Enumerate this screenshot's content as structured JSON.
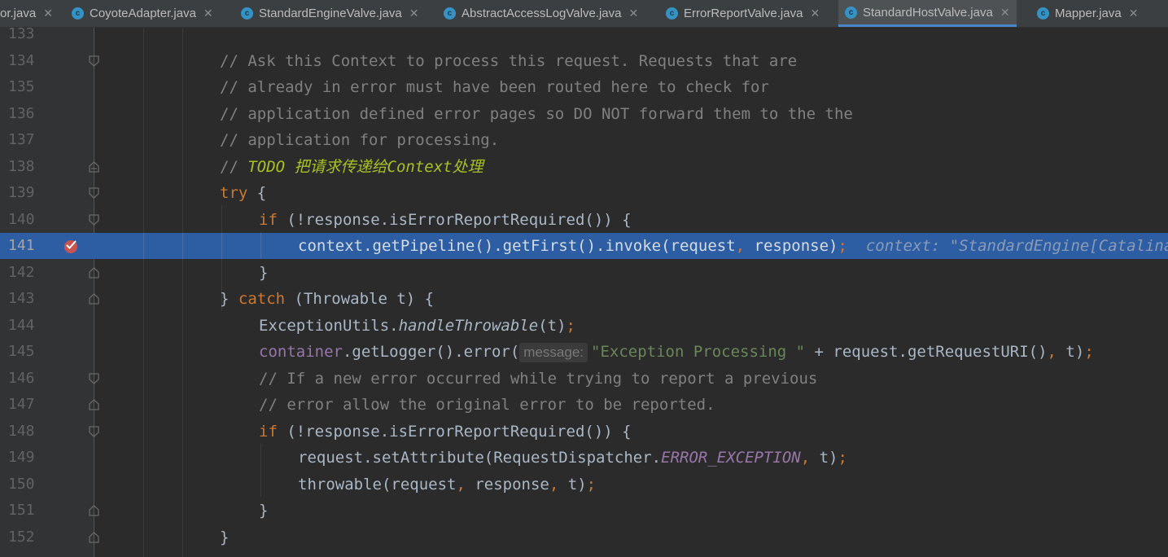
{
  "tabs": [
    {
      "label": "or.java",
      "active": false,
      "icon": false
    },
    {
      "label": "CoyoteAdapter.java",
      "active": false,
      "icon": true
    },
    {
      "label": "StandardEngineValve.java",
      "active": false,
      "icon": true
    },
    {
      "label": "AbstractAccessLogValve.java",
      "active": false,
      "icon": true
    },
    {
      "label": "ErrorReportValve.java",
      "active": false,
      "icon": true
    },
    {
      "label": "StandardHostValve.java",
      "active": true,
      "icon": true
    },
    {
      "label": "Mapper.java",
      "active": false,
      "icon": true
    }
  ],
  "tab_icon_letter": "c",
  "close_glyph": "✕",
  "lines": [
    {
      "num": "133"
    },
    {
      "num": "134",
      "comment": "// Ask this Context to process this request. Requests that are"
    },
    {
      "num": "135",
      "comment": "// already in error must have been routed here to check for"
    },
    {
      "num": "136",
      "comment": "// application defined error pages so DO NOT forward them to the the"
    },
    {
      "num": "137",
      "comment": "// application for processing."
    },
    {
      "num": "138",
      "comment": "// ",
      "todo": "TODO 把请求传递给Context处理"
    },
    {
      "num": "139",
      "kw": "try",
      "rest": " {"
    },
    {
      "num": "140",
      "kw": "if",
      "rest": " (!response.isErrorReportRequired()) {"
    },
    {
      "num": "141",
      "code": "context.getPipeline().getFirst().invoke(request",
      "comma": ",",
      "code2": " response)",
      "semi": ";",
      "debug": "context: \"StandardEngine[Catalina]"
    },
    {
      "num": "142",
      "rest": "}"
    },
    {
      "num": "143",
      "pre": "} ",
      "kw": "catch",
      "rest": " (Throwable t) {"
    },
    {
      "num": "144",
      "pre": "ExceptionUtils.",
      "italic": "handleThrowable",
      "rest": "(t)",
      "semi": ";"
    },
    {
      "num": "145",
      "field": "container",
      "rest": ".getLogger().error(",
      "hint": "message:",
      "string": "\"Exception Processing \"",
      "rest2": " + request.getRequestURI()",
      "comma": ",",
      "rest3": " t)",
      "semi": ";"
    },
    {
      "num": "146",
      "comment": "// If a new error occurred while trying to report a previous"
    },
    {
      "num": "147",
      "comment": "// error allow the original error to be reported."
    },
    {
      "num": "148",
      "kw": "if",
      "rest": " (!response.isErrorReportRequired()) {"
    },
    {
      "num": "149",
      "pre": "request.setAttribute(RequestDispatcher.",
      "sfield": "ERROR_EXCEPTION",
      "comma": ",",
      "rest": " t)",
      "semi": ";"
    },
    {
      "num": "150",
      "pre": "throwable(request",
      "comma": ",",
      "mid": " response",
      "comma2": ",",
      "rest": " t)",
      "semi": ";"
    },
    {
      "num": "151",
      "rest": "}"
    },
    {
      "num": "152",
      "rest": "}"
    }
  ],
  "colors": {
    "background": "#2b2b2b",
    "gutter": "#313335",
    "execution_line": "#2d5ea3",
    "keyword": "#cc7832",
    "comment": "#808080",
    "string": "#6a8759",
    "field": "#9876aa",
    "todo": "#a8c023",
    "tab_icon": "#3592c4"
  },
  "breakpoint": {
    "line": "141",
    "icon": "breakpoint-checked-icon"
  }
}
